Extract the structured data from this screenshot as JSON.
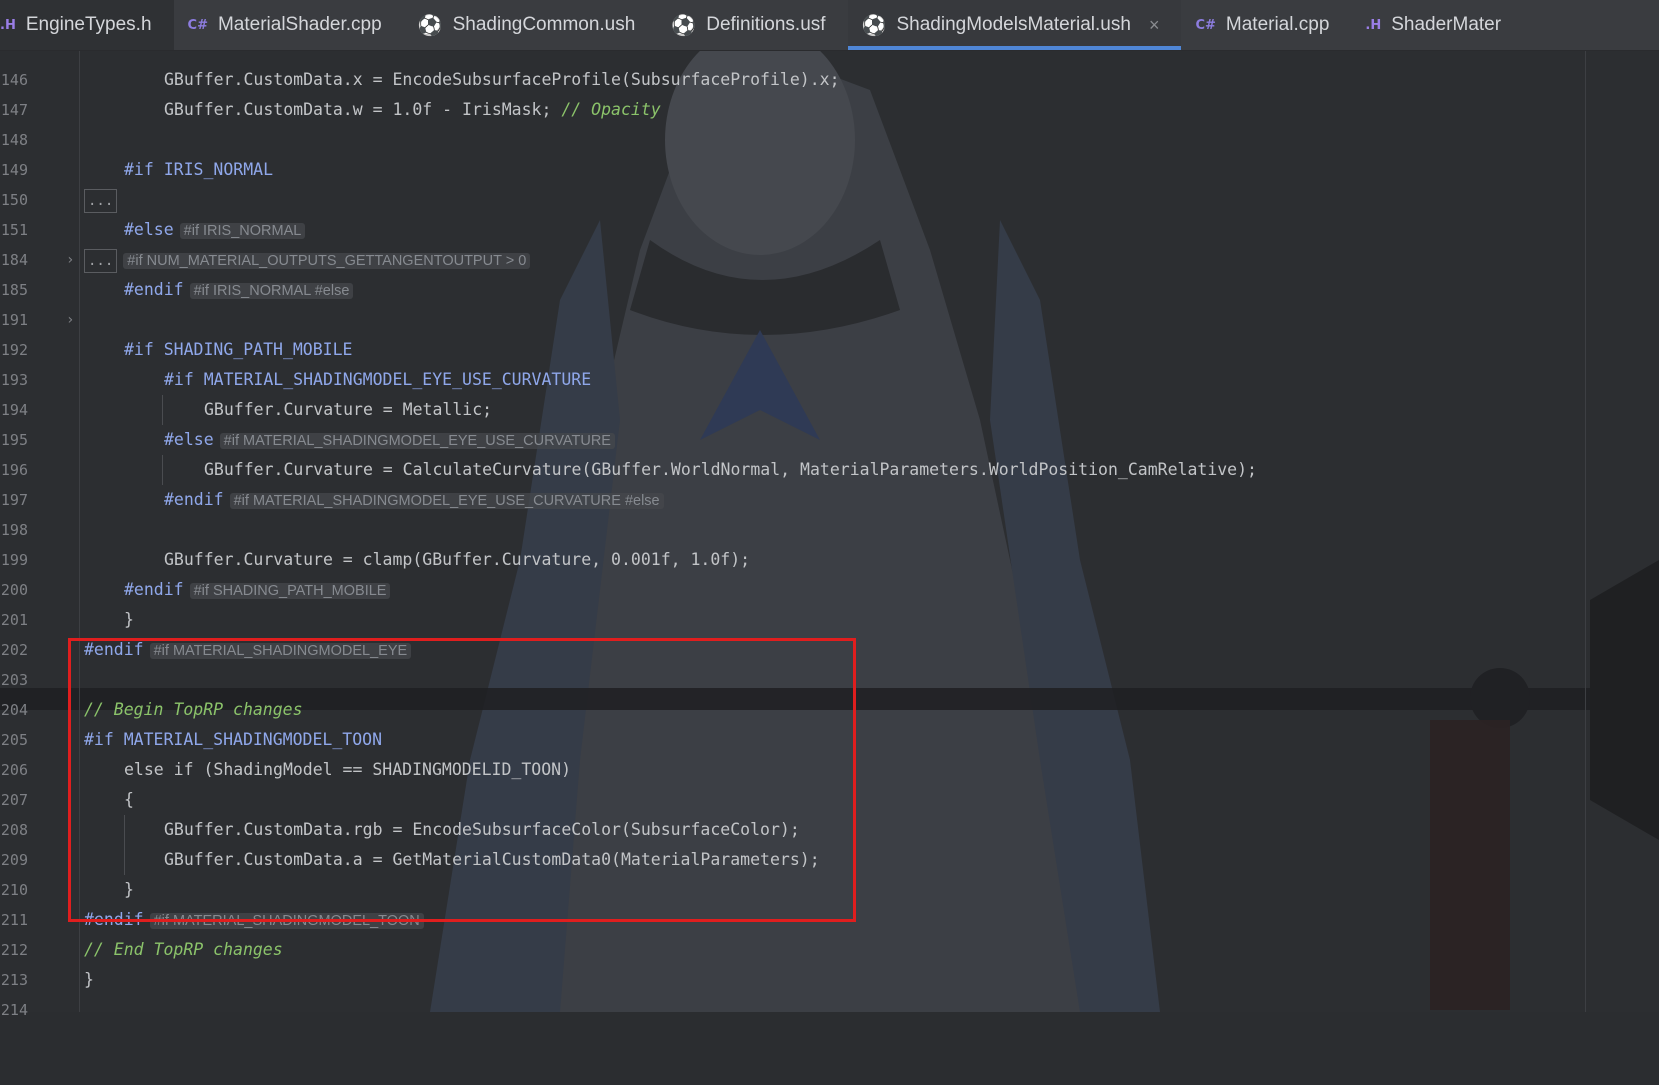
{
  "tabs": [
    {
      "icon": ".H",
      "label": "EngineTypes.h",
      "active": false
    },
    {
      "icon": "C#",
      "label": "MaterialShader.cpp",
      "active": false
    },
    {
      "icon": "ush",
      "label": "ShadingCommon.ush",
      "active": false
    },
    {
      "icon": "ush",
      "label": "Definitions.usf",
      "active": false
    },
    {
      "icon": "ush",
      "label": "ShadingModelsMaterial.ush",
      "active": true,
      "close": "×"
    },
    {
      "icon": "C#",
      "label": "Material.cpp",
      "active": false
    },
    {
      "icon": ".H",
      "label": "ShaderMater",
      "active": false
    }
  ],
  "code": {
    "l146": {
      "num": "146"
    },
    "l147": {
      "num": "147",
      "text": "GBuffer.CustomData.x = EncodeSubsurfaceProfile(SubsurfaceProfile).x;"
    },
    "l148": {
      "num": "148",
      "text": "GBuffer.CustomData.w = 1.0f - IrisMask; ",
      "comment": "// Opacity"
    },
    "l149": {
      "num": "149"
    },
    "l150": {
      "num": "150",
      "text": "#if IRIS_NORMAL"
    },
    "l151": {
      "num": "151",
      "fold": "..."
    },
    "l184": {
      "num": "184",
      "text": "#else",
      "hint": "#if IRIS_NORMAL"
    },
    "l185": {
      "num": "185",
      "fold": "...",
      "hint": "#if NUM_MATERIAL_OUTPUTS_GETTANGENTOUTPUT > 0"
    },
    "l191": {
      "num": "191",
      "text": "#endif",
      "hint": "#if IRIS_NORMAL #else"
    },
    "l192": {
      "num": "192"
    },
    "l193": {
      "num": "193",
      "text": "#if SHADING_PATH_MOBILE"
    },
    "l194": {
      "num": "194",
      "text": "#if MATERIAL_SHADINGMODEL_EYE_USE_CURVATURE"
    },
    "l195": {
      "num": "195",
      "text": "GBuffer.Curvature = Metallic;"
    },
    "l196": {
      "num": "196",
      "text": "#else",
      "hint": "#if MATERIAL_SHADINGMODEL_EYE_USE_CURVATURE"
    },
    "l197": {
      "num": "197",
      "text": "GBuffer.Curvature = CalculateCurvature(GBuffer.WorldNormal, MaterialParameters.WorldPosition_CamRelative);"
    },
    "l198": {
      "num": "198",
      "text": "#endif",
      "hint": "#if MATERIAL_SHADINGMODEL_EYE_USE_CURVATURE #else"
    },
    "l199": {
      "num": "199"
    },
    "l200": {
      "num": "200",
      "text": "GBuffer.Curvature = clamp(GBuffer.Curvature, 0.001f, 1.0f);"
    },
    "l201": {
      "num": "201",
      "text": "#endif",
      "hint": "#if SHADING_PATH_MOBILE"
    },
    "l202": {
      "num": "202",
      "text": "}"
    },
    "l203": {
      "num": "203",
      "text": "#endif",
      "hint": "#if MATERIAL_SHADINGMODEL_EYE"
    },
    "l204": {
      "num": "204"
    },
    "l205": {
      "num": "205",
      "comment": "// Begin TopRP changes"
    },
    "l206": {
      "num": "206",
      "text": "#if MATERIAL_SHADINGMODEL_TOON"
    },
    "l207": {
      "num": "207",
      "text": "else if (ShadingModel == SHADINGMODELID_TOON)"
    },
    "l208": {
      "num": "208",
      "text": "{"
    },
    "l209": {
      "num": "209",
      "text": "GBuffer.CustomData.rgb = EncodeSubsurfaceColor(SubsurfaceColor);"
    },
    "l210": {
      "num": "210",
      "text": "GBuffer.CustomData.a = GetMaterialCustomData0(MaterialParameters);"
    },
    "l211": {
      "num": "211",
      "text": "}"
    },
    "l212": {
      "num": "212",
      "text": "#endif",
      "hint": "#if MATERIAL_SHADINGMODEL_TOON"
    },
    "l213": {
      "num": "213",
      "comment": "// End TopRP changes"
    },
    "l214": {
      "num": "214",
      "text": "}"
    }
  },
  "colors": {
    "accent": "#4f86d6",
    "directive": "#8fa7ea",
    "comment": "#8bc36a",
    "highlight_box": "#e01e1e"
  }
}
